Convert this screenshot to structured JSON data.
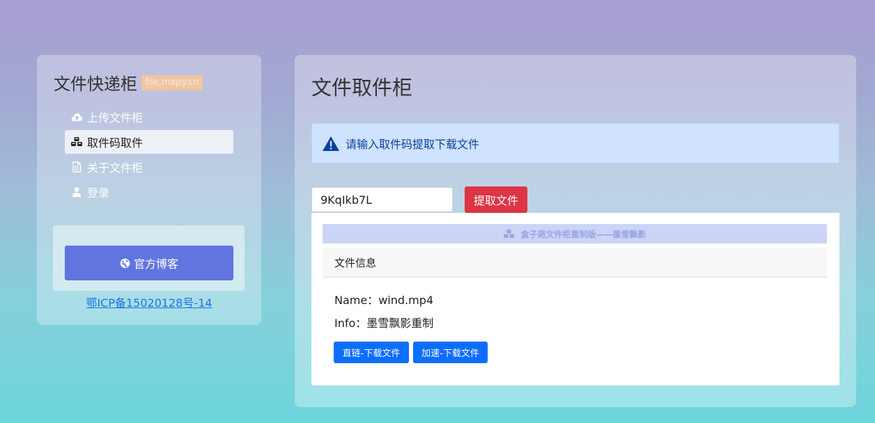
{
  "sidebar": {
    "brand": "文件快递柜",
    "brand_badge": "file.mxpy.cn",
    "nav": [
      {
        "label": "上传文件柜",
        "icon": "cloud-upload-icon"
      },
      {
        "label": "取件码取件",
        "icon": "cubes-icon"
      },
      {
        "label": "关于文件柜",
        "icon": "document-icon"
      },
      {
        "label": "登录",
        "icon": "user-icon"
      }
    ],
    "blog_button": "官方博客",
    "icp": "鄂ICP备15020128号-14"
  },
  "main": {
    "title": "文件取件柜",
    "alert": "请输入取件码提取下载文件",
    "code_value": "9KqIkb7L",
    "fetch_button": "提取文件",
    "banner": "盒子葩文件柜重制版——墨雪飘影",
    "card_header": "文件信息",
    "file_name": "Name：wind.mp4",
    "file_info": "Info：墨雪飘影重制",
    "download_direct": "直链-下载文件",
    "download_speed": "加速-下载文件"
  },
  "colors": {
    "accent_blue": "#0d6efd",
    "danger_red": "#dc3545",
    "blog_button": "#6274e0",
    "alert_bg": "#cfe2ff"
  }
}
